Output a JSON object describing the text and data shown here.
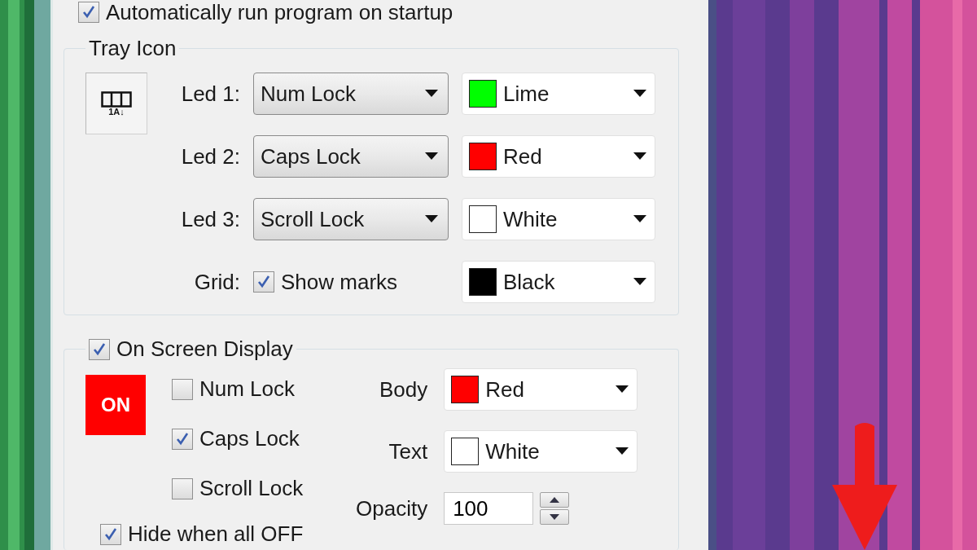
{
  "startup": {
    "label": "Automatically run program on startup",
    "checked": true
  },
  "tray_icon": {
    "title": "Tray Icon",
    "icon_caption": "1A↓",
    "leds": [
      {
        "label": "Led 1:",
        "key": "Num Lock",
        "color_name": "Lime",
        "color": "#00ff00"
      },
      {
        "label": "Led 2:",
        "key": "Caps Lock",
        "color_name": "Red",
        "color": "#ff0000"
      },
      {
        "label": "Led 3:",
        "key": "Scroll Lock",
        "color_name": "White",
        "color": "#ffffff"
      }
    ],
    "grid": {
      "label": "Grid:",
      "option": "Show marks",
      "checked": true,
      "color_name": "Black",
      "color": "#000000"
    }
  },
  "osd": {
    "title": "On Screen Display",
    "checked": true,
    "preview": "ON",
    "locks": [
      {
        "label": "Num Lock",
        "checked": false
      },
      {
        "label": "Caps Lock",
        "checked": true
      },
      {
        "label": "Scroll Lock",
        "checked": false
      }
    ],
    "body": {
      "label": "Body",
      "color_name": "Red",
      "color": "#ff0000"
    },
    "text": {
      "label": "Text",
      "color_name": "White",
      "color": "#ffffff"
    },
    "opacity": {
      "label": "Opacity",
      "value": "100"
    },
    "hide_when_off": {
      "label": "Hide when all OFF",
      "checked": true
    }
  }
}
